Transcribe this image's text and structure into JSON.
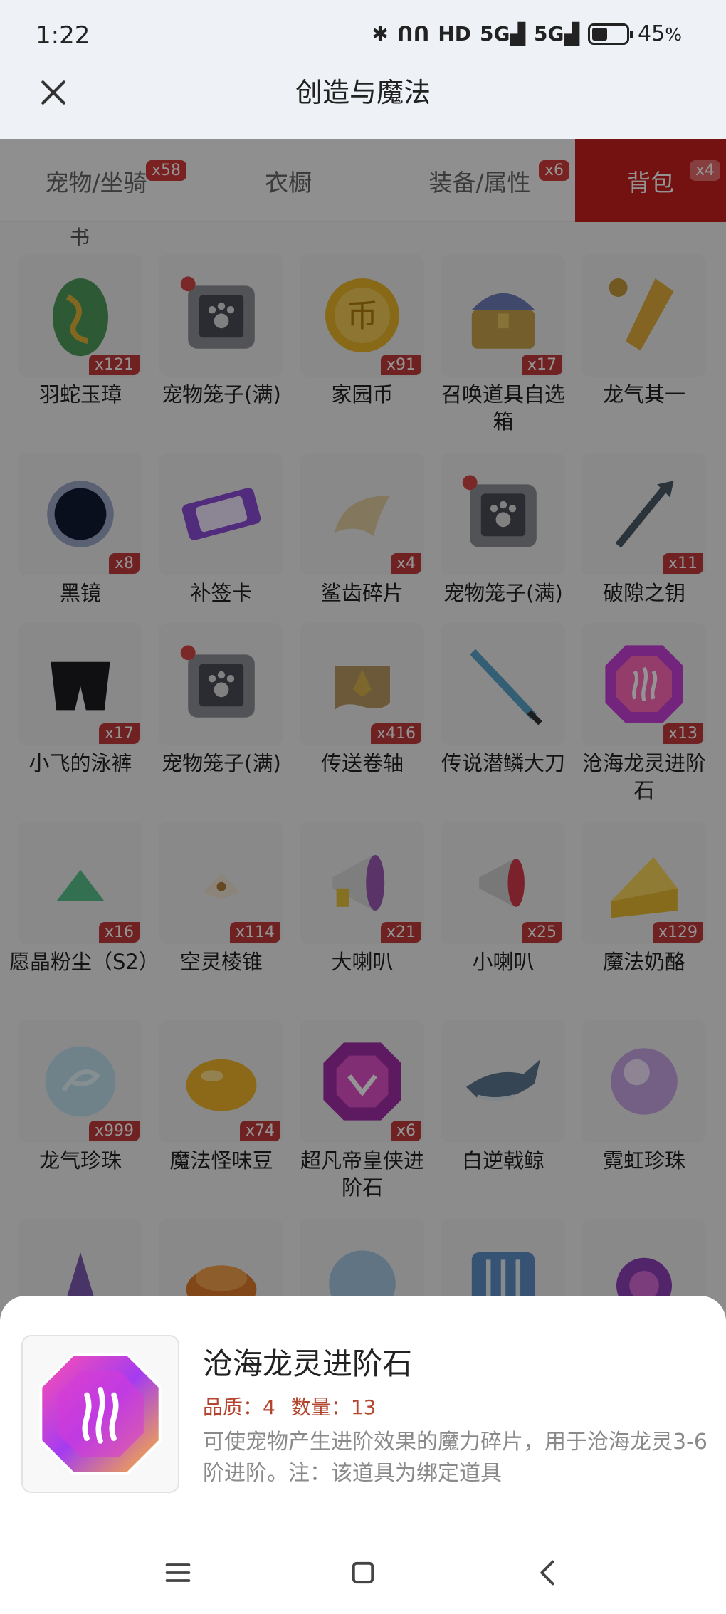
{
  "status_bar": {
    "time": "1:22",
    "network1": "5G",
    "network2": "5G",
    "battery_percent": "45",
    "battery_suffix": "%",
    "battery_level": 0.45
  },
  "header": {
    "title": "创造与魔法"
  },
  "tabs": [
    {
      "label": "宠物/坐骑",
      "badge": "x58",
      "active": false
    },
    {
      "label": "衣橱",
      "badge": "",
      "active": false
    },
    {
      "label": "装备/属性",
      "badge": "x6",
      "active": false
    },
    {
      "label": "背包",
      "badge": "x4",
      "active": true
    }
  ],
  "stub_text": "书",
  "items": [
    {
      "name": "羽蛇玉璋",
      "count": "x121",
      "icon": "jade-serpent-icon"
    },
    {
      "name": "宠物笼子(满)",
      "count": "",
      "icon": "pet-cage-icon"
    },
    {
      "name": "家园币",
      "count": "x91",
      "icon": "gold-coin-icon"
    },
    {
      "name": "召唤道具自选箱",
      "count": "x17",
      "icon": "treasure-chest-icon"
    },
    {
      "name": "龙气其一",
      "count": "",
      "icon": "golden-shard-icon"
    },
    {
      "name": "黑镜",
      "count": "x8",
      "icon": "black-mirror-icon"
    },
    {
      "name": "补签卡",
      "count": "",
      "icon": "card-icon"
    },
    {
      "name": "鲨齿碎片",
      "count": "x4",
      "icon": "shark-tooth-icon"
    },
    {
      "name": "宠物笼子(满)",
      "count": "",
      "icon": "pet-cage-icon"
    },
    {
      "name": "破隙之钥",
      "count": "x11",
      "icon": "key-icon"
    },
    {
      "name": "小飞的泳裤",
      "count": "x17",
      "icon": "swim-trunks-icon"
    },
    {
      "name": "宠物笼子(满)",
      "count": "",
      "icon": "pet-cage-icon"
    },
    {
      "name": "传送卷轴",
      "count": "x416",
      "icon": "scroll-icon"
    },
    {
      "name": "传说潜鳞大刀",
      "count": "",
      "icon": "blade-icon"
    },
    {
      "name": "沧海龙灵进阶石",
      "count": "x13",
      "icon": "gem-stone-icon"
    },
    {
      "name": "愿晶粉尘（S2）",
      "count": "x16",
      "icon": "crystal-dust-icon"
    },
    {
      "name": "空灵棱锥",
      "count": "x114",
      "icon": "prism-icon"
    },
    {
      "name": "大喇叭",
      "count": "x21",
      "icon": "big-megaphone-icon"
    },
    {
      "name": "小喇叭",
      "count": "x25",
      "icon": "small-megaphone-icon"
    },
    {
      "name": "魔法奶酪",
      "count": "x129",
      "icon": "cheese-icon"
    },
    {
      "name": "龙气珍珠",
      "count": "x999",
      "icon": "dragon-pearl-icon"
    },
    {
      "name": "魔法怪味豆",
      "count": "x74",
      "icon": "bean-icon"
    },
    {
      "name": "超凡帝皇侠进阶石",
      "count": "x6",
      "icon": "emperor-gem-icon"
    },
    {
      "name": "白逆戟鲸",
      "count": "",
      "icon": "whale-icon"
    },
    {
      "name": "霓虹珍珠",
      "count": "",
      "icon": "rainbow-pearl-icon"
    },
    {
      "name": "",
      "count": "",
      "icon": "purple-cone-icon"
    },
    {
      "name": "",
      "count": "",
      "icon": "orange-cake-icon"
    },
    {
      "name": "",
      "count": "",
      "icon": "dragon-orb-icon"
    },
    {
      "name": "",
      "count": "",
      "icon": "blue-cage-icon"
    },
    {
      "name": "",
      "count": "",
      "icon": "purple-creature-icon"
    }
  ],
  "detail": {
    "name": "沧海龙灵进阶石",
    "quality_label": "品质：",
    "quality": "4",
    "quantity_label": "数量：",
    "quantity": "13",
    "description": "可使宠物产生进阶效果的魔力碎片，用于沧海龙灵3-6阶进阶。注：该道具为绑定道具"
  },
  "colors": {
    "accent": "#c81e1e",
    "badge": "#c23b3b",
    "meta": "#b4442e"
  }
}
